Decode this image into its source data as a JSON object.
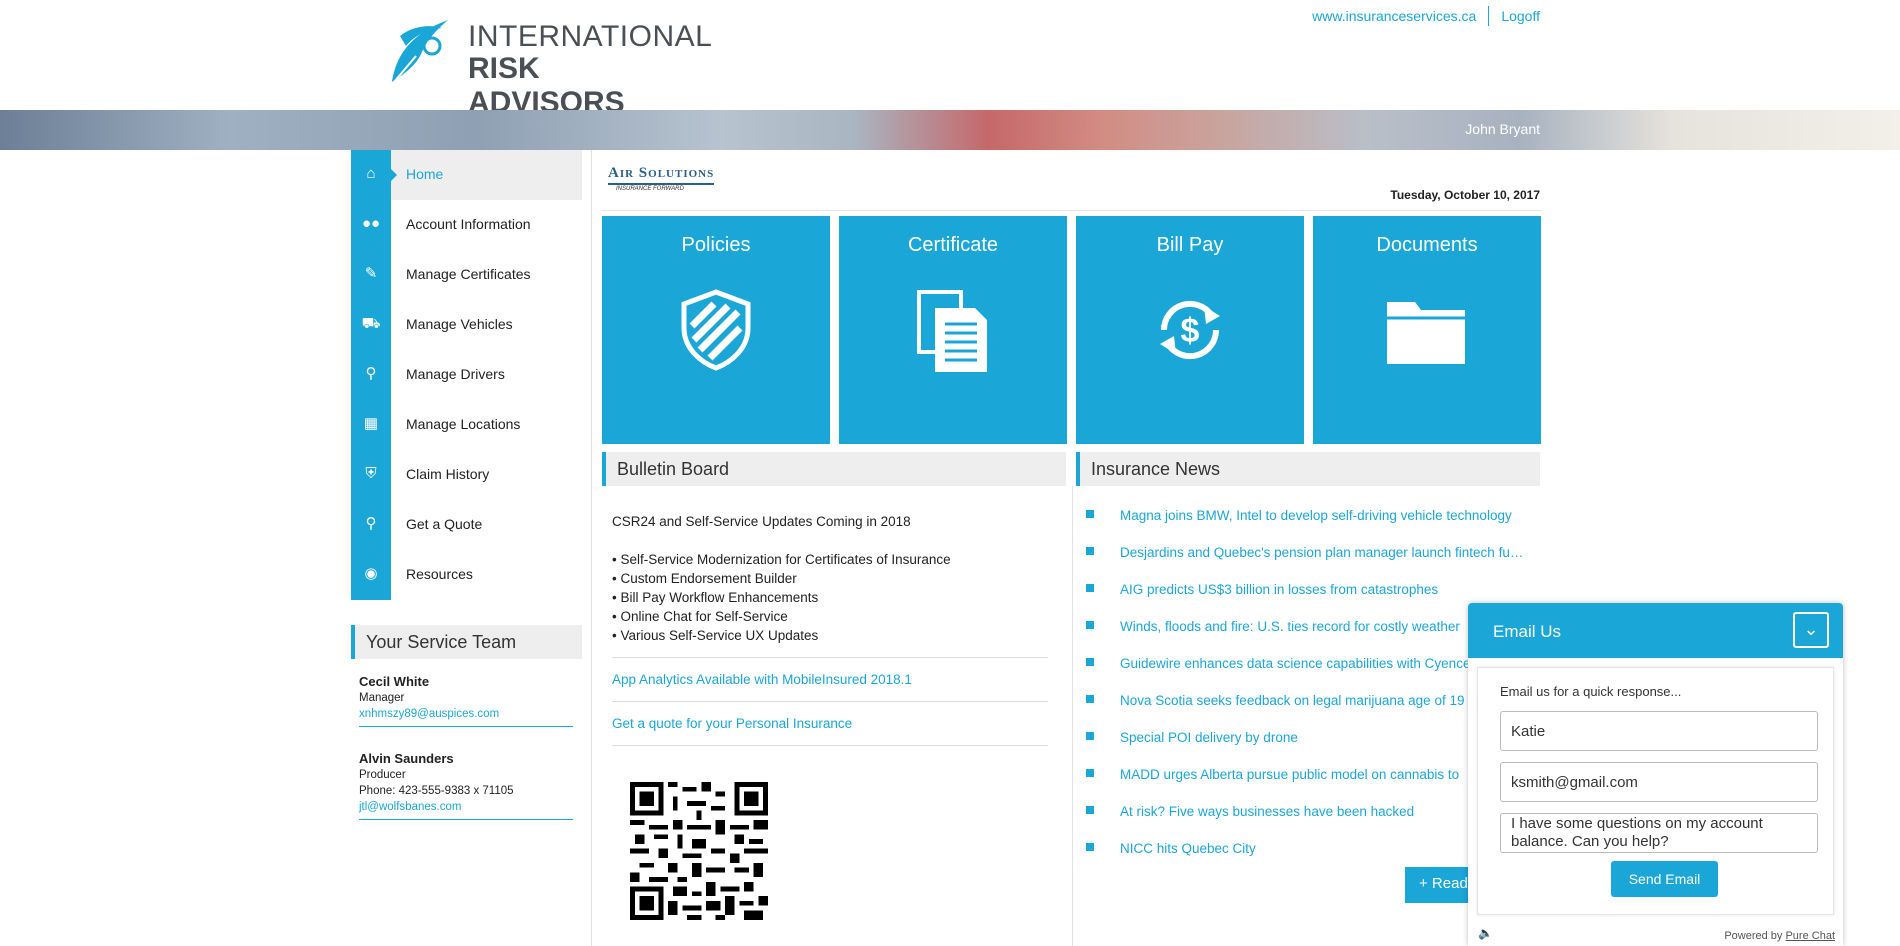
{
  "header": {
    "logo_line1": "INTERNATIONAL",
    "logo_line2": "RISK ADVISORS",
    "website_link": "www.insuranceservices.ca",
    "logoff_link": "Logoff",
    "user_name": "John Bryant"
  },
  "sidebar": {
    "items": [
      {
        "label": "Home",
        "icon": "home-icon",
        "active": true
      },
      {
        "label": "Account Information",
        "icon": "users-icon"
      },
      {
        "label": "Manage Certificates",
        "icon": "edit-icon"
      },
      {
        "label": "Manage Vehicles",
        "icon": "truck-icon"
      },
      {
        "label": "Manage Drivers",
        "icon": "key-icon"
      },
      {
        "label": "Manage Locations",
        "icon": "building-icon"
      },
      {
        "label": "Claim History",
        "icon": "shield-dollar-icon"
      },
      {
        "label": "Get a Quote",
        "icon": "search-dollar-icon"
      },
      {
        "label": "Resources",
        "icon": "globe-icon"
      }
    ]
  },
  "service_team": {
    "title": "Your Service Team",
    "members": [
      {
        "name": "Cecil White",
        "role": "Manager",
        "email": "xnhmszy89@auspices.com"
      },
      {
        "name": "Alvin Saunders",
        "role": "Producer",
        "phone": "Phone: 423-555-9383 x 71105",
        "email": "jtl@wolfsbanes.com"
      }
    ]
  },
  "main": {
    "company_logo_line1": "Air Solutions",
    "company_logo_line2": "INSURANCE FORWARD",
    "date": "Tuesday, October 10, 2017",
    "tiles": [
      {
        "label": "Policies",
        "icon": "shield-icon"
      },
      {
        "label": "Certificate",
        "icon": "documents-copy-icon"
      },
      {
        "label": "Bill Pay",
        "icon": "dollar-cycle-icon"
      },
      {
        "label": "Documents",
        "icon": "folder-icon"
      }
    ]
  },
  "bulletin": {
    "title": "Bulletin Board",
    "heading": "CSR24 and Self-Service Updates Coming in 2018",
    "bullets": [
      "• Self-Service Modernization for Certificates of Insurance",
      "• Custom Endorsement Builder",
      "• Bill Pay Workflow Enhancements",
      "• Online Chat for Self-Service",
      "• Various Self-Service UX Updates"
    ],
    "link1": "App Analytics Available with MobileInsured 2018.1",
    "link2": "Get a quote for your Personal Insurance"
  },
  "news": {
    "title": "Insurance News",
    "items": [
      "Magna joins BMW, Intel to develop self-driving vehicle technology",
      "Desjardins and Quebec's pension plan manager launch fintech fund",
      "AIG predicts US$3 billion in losses from catastrophes",
      "Winds, floods and fire: U.S. ties record for costly weather",
      "Guidewire enhances data science capabilities with Cyence",
      "Nova Scotia seeks feedback on legal marijuana age of 19",
      "Special POI delivery by drone",
      "MADD urges Alberta pursue public model on cannabis to",
      "At risk? Five ways businesses have been hacked",
      "NICC hits Quebec City"
    ],
    "read_more": "+ Read More"
  },
  "chat": {
    "title": "Email Us",
    "intro": "Email us for a quick response...",
    "name_value": "Katie",
    "email_value": "ksmith@gmail.com",
    "message_value": "I have some questions on my account balance. Can you help?",
    "send_label": "Send Email",
    "powered_by": "Powered by",
    "powered_link": "Pure Chat"
  },
  "colors": {
    "accent": "#1ba6d8"
  }
}
